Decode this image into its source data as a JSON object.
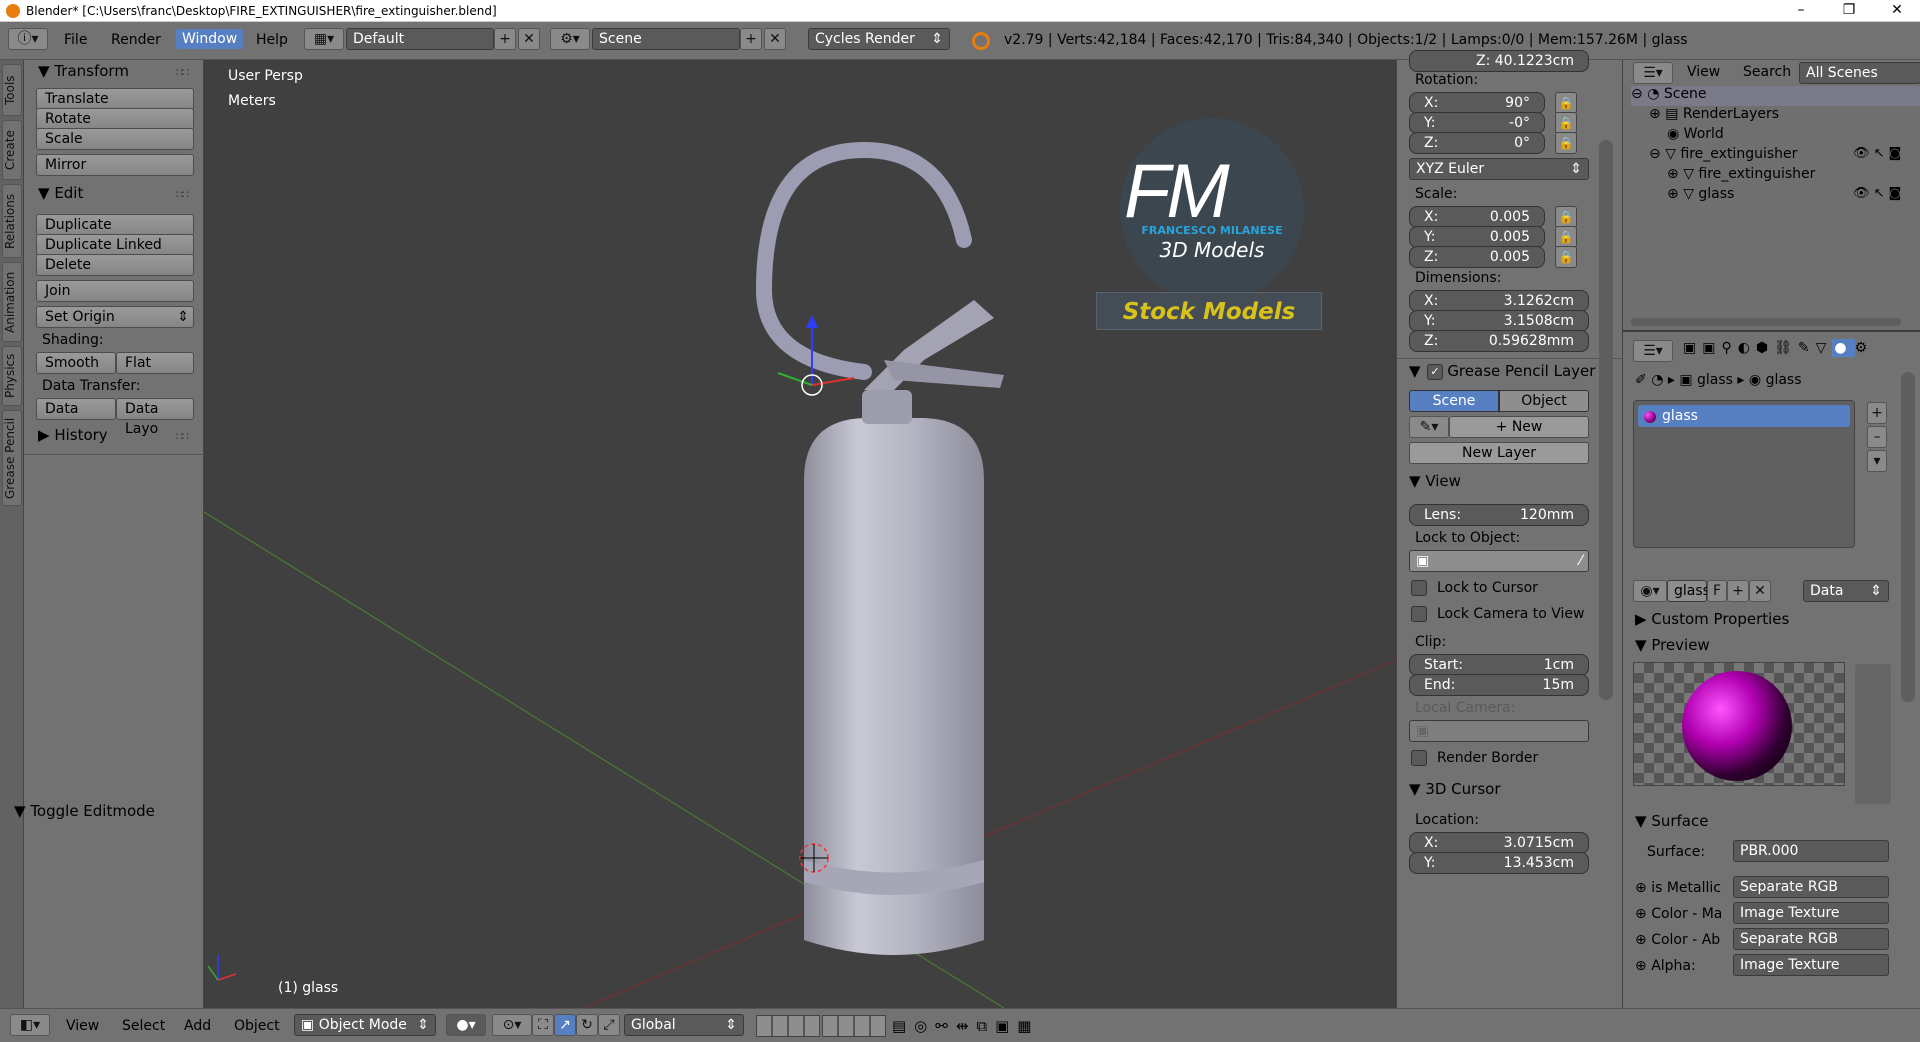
{
  "window": {
    "title": "Blender* [C:\\Users\\franc\\Desktop\\FIRE_EXTINGUISHER\\fire_extinguisher.blend]",
    "min": "–",
    "max": "❐",
    "close": "✕"
  },
  "info": {
    "menus": [
      "File",
      "Render",
      "Window",
      "Help"
    ],
    "active_menu": "Window",
    "layout": "Default",
    "scene": "Scene",
    "engine": "Cycles Render",
    "stats": "v2.79 | Verts:42,184 | Faces:42,170 | Tris:84,340 | Objects:1/2 | Lamps:0/0 | Mem:157.26M | glass"
  },
  "tabs": [
    "Tools",
    "Create",
    "Relations",
    "Animation",
    "Physics",
    "Grease Pencil"
  ],
  "toolshelf": {
    "transform_title": "Transform",
    "translate": "Translate",
    "rotate": "Rotate",
    "scale": "Scale",
    "mirror": "Mirror",
    "edit_title": "Edit",
    "duplicate": "Duplicate",
    "duplicate_linked": "Duplicate Linked",
    "delete": "Delete",
    "join": "Join",
    "set_origin": "Set Origin",
    "shading_label": "Shading:",
    "smooth": "Smooth",
    "flat": "Flat",
    "data_transfer_label": "Data Transfer:",
    "data": "Data",
    "data_layo": "Data Layo",
    "history": "History",
    "toggle_editmode": "Toggle Editmode"
  },
  "viewport": {
    "view_name": "User Persp",
    "units": "Meters",
    "object_label": "(1) glass",
    "logo_fm": "FM",
    "logo_name": "FRANCESCO MILANESE",
    "logo_3d": "3D Models",
    "stock": "Stock Models"
  },
  "props": {
    "loc_z_partial": "Z:   40.1223cm",
    "rotation_label": "Rotation:",
    "rot_x_k": "X:",
    "rot_x": "90°",
    "rot_y_k": "Y:",
    "rot_y": "-0°",
    "rot_z_k": "Z:",
    "rot_z": "0°",
    "euler": "XYZ Euler",
    "scale_label": "Scale:",
    "sc_x_k": "X:",
    "sc_x": "0.005",
    "sc_y_k": "Y:",
    "sc_y": "0.005",
    "sc_z_k": "Z:",
    "sc_z": "0.005",
    "dim_label": "Dimensions:",
    "dim_x_k": "X:",
    "dim_x": "3.1262cm",
    "dim_y_k": "Y:",
    "dim_y": "3.1508cm",
    "dim_z_k": "Z:",
    "dim_z": "0.59628mm",
    "gp_title": "Grease Pencil Layer",
    "gp_scene": "Scene",
    "gp_object": "Object",
    "gp_new": "New",
    "gp_new_layer": "New Layer",
    "view_title": "View",
    "lens_k": "Lens:",
    "lens": "120mm",
    "lock_obj_label": "Lock to Object:",
    "lock_cursor": "Lock to Cursor",
    "lock_camera": "Lock Camera to View",
    "clip_label": "Clip:",
    "clip_start_k": "Start:",
    "clip_start": "1cm",
    "clip_end_k": "End:",
    "clip_end": "15m",
    "local_camera": "Local Camera:",
    "render_border": "Render Border",
    "cursor_title": "3D Cursor",
    "location_label": "Location:",
    "cur_x_k": "X:",
    "cur_x": "3.0715cm",
    "cur_y_k": "Y:",
    "cur_y": "13.453cm"
  },
  "outliner": {
    "view": "View",
    "search": "Search",
    "all_scenes": "All Scenes",
    "items": [
      "Scene",
      "RenderLayers",
      "World",
      "fire_extinguisher",
      "fire_extinguisher",
      "glass"
    ]
  },
  "material": {
    "crumb_obj": "glass",
    "crumb_mat": "glass",
    "slot": "glass",
    "mat_name": "glass",
    "fake": "F",
    "link": "Data",
    "custom_props": "Custom Properties",
    "preview": "Preview",
    "surface_title": "Surface",
    "surface_label": "Surface:",
    "surface_val": "PBR.000",
    "rows": [
      {
        "k": "is Metallic",
        "v": "Separate RGB"
      },
      {
        "k": "Color - Ma",
        "v": "Image Texture"
      },
      {
        "k": "Color - Ab",
        "v": "Separate RGB"
      },
      {
        "k": "Alpha:",
        "v": "Image Texture"
      }
    ]
  },
  "bottom": {
    "menus": [
      "View",
      "Select",
      "Add",
      "Object"
    ],
    "mode": "Object Mode",
    "orient": "Global"
  },
  "colors": {
    "accent": "#5680c2",
    "panel": "#727272",
    "viewport": "#404040",
    "logo_blue": "#29a3dc",
    "stock_yellow": "#d8c21a"
  }
}
